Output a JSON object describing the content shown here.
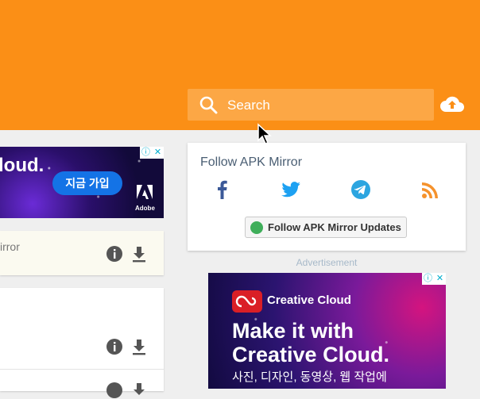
{
  "header": {
    "search_placeholder": "Search",
    "search_icon": "search-icon",
    "upload_icon": "cloud-upload-icon"
  },
  "ad_left": {
    "headline": "loud.",
    "cta": "지금 가입",
    "brand": "Adobe"
  },
  "cards": [
    {
      "text": "irror"
    }
  ],
  "follow": {
    "title": "Follow APK Mirror",
    "social": [
      "facebook-icon",
      "twitter-icon",
      "telegram-icon",
      "rss-icon"
    ],
    "button": "Follow APK Mirror Updates"
  },
  "advertisement_label": "Advertisement",
  "ad_right": {
    "brand": "Creative Cloud",
    "headline_1": "Make it with",
    "headline_2": "Creative Cloud.",
    "subline": "사진, 디자인, 동영상, 웹 작업에"
  },
  "colors": {
    "header": "#fb8f16",
    "search_bg": "#fca745",
    "facebook": "#3b5998",
    "twitter": "#1da1f2",
    "telegram": "#2ca5e0",
    "rss": "#f5922c"
  }
}
